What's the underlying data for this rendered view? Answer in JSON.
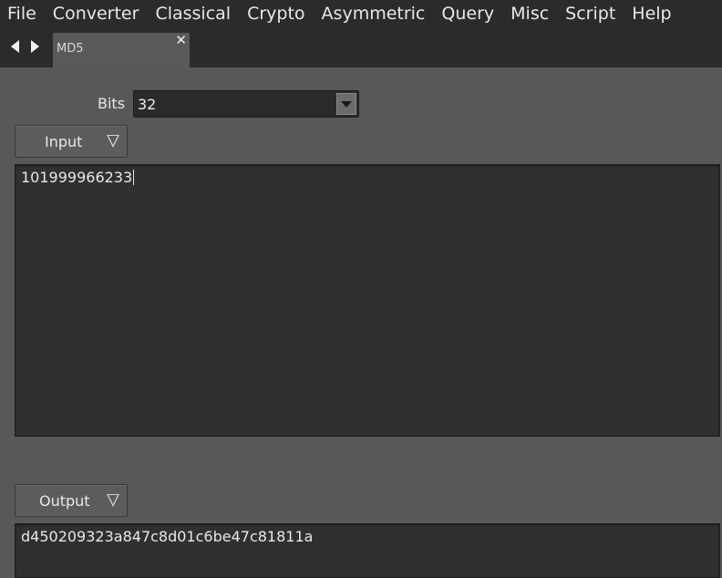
{
  "menu": [
    "File",
    "Converter",
    "Classical",
    "Crypto",
    "Asymmetric",
    "Query",
    "Misc",
    "Script",
    "Help"
  ],
  "tabs": {
    "active_label": "MD5",
    "close_glyph": "✕"
  },
  "bits": {
    "label": "Bits",
    "value": "32"
  },
  "input": {
    "button_label": "Input",
    "text": "101999966233"
  },
  "output": {
    "button_label": "Output",
    "text": "d450209323a847c8d01c6be47c81811a"
  }
}
